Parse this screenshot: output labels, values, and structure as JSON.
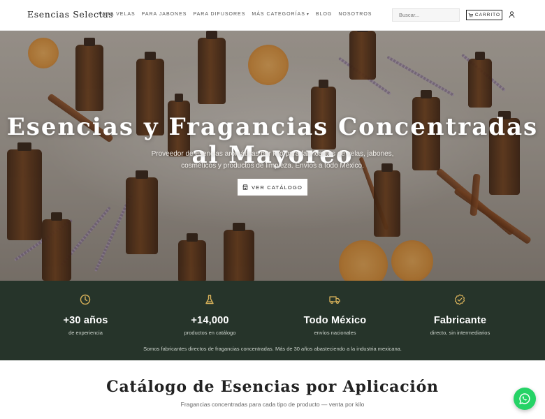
{
  "header": {
    "logo": "Esencias Selectas",
    "nav": [
      {
        "label": "PARA VELAS"
      },
      {
        "label": "PARA JABONES"
      },
      {
        "label": "PARA DIFUSORES"
      },
      {
        "label": "MÁS CATEGORÍAS"
      },
      {
        "label": "BLOG"
      },
      {
        "label": "NOSOTROS"
      }
    ],
    "search_placeholder": "Buscar...",
    "cart_label": "CARRITO"
  },
  "hero": {
    "title": "Esencias y Fragancias Concentradas al Mayoreo",
    "subtitle": "Proveedor de esencias aromáticas por kilo para fabricantes de velas, jabones, cosméticos y productos de limpieza. Envíos a todo México.",
    "cta_label": "VER CATÁLOGO"
  },
  "stats": {
    "items": [
      {
        "value": "+30 años",
        "label": "de experiencia",
        "icon": "clock-icon"
      },
      {
        "value": "+14,000",
        "label": "productos en catálogo",
        "icon": "flask-icon"
      },
      {
        "value": "Todo México",
        "label": "envíos nacionales",
        "icon": "truck-icon"
      },
      {
        "value": "Fabricante",
        "label": "directo, sin intermediarios",
        "icon": "check-badge-icon"
      }
    ],
    "note": "Somos fabricantes directos de fragancias concentradas. Más de 30 años abasteciendo a la industria mexicana."
  },
  "catalog": {
    "title": "Catálogo de Esencias por Aplicación",
    "subtitle": "Fragancias concentradas para cada tipo de producto — venta por kilo"
  },
  "colors": {
    "stats_bg": "#26342a",
    "accent_gold": "#d9b25a",
    "whatsapp": "#25d366"
  }
}
